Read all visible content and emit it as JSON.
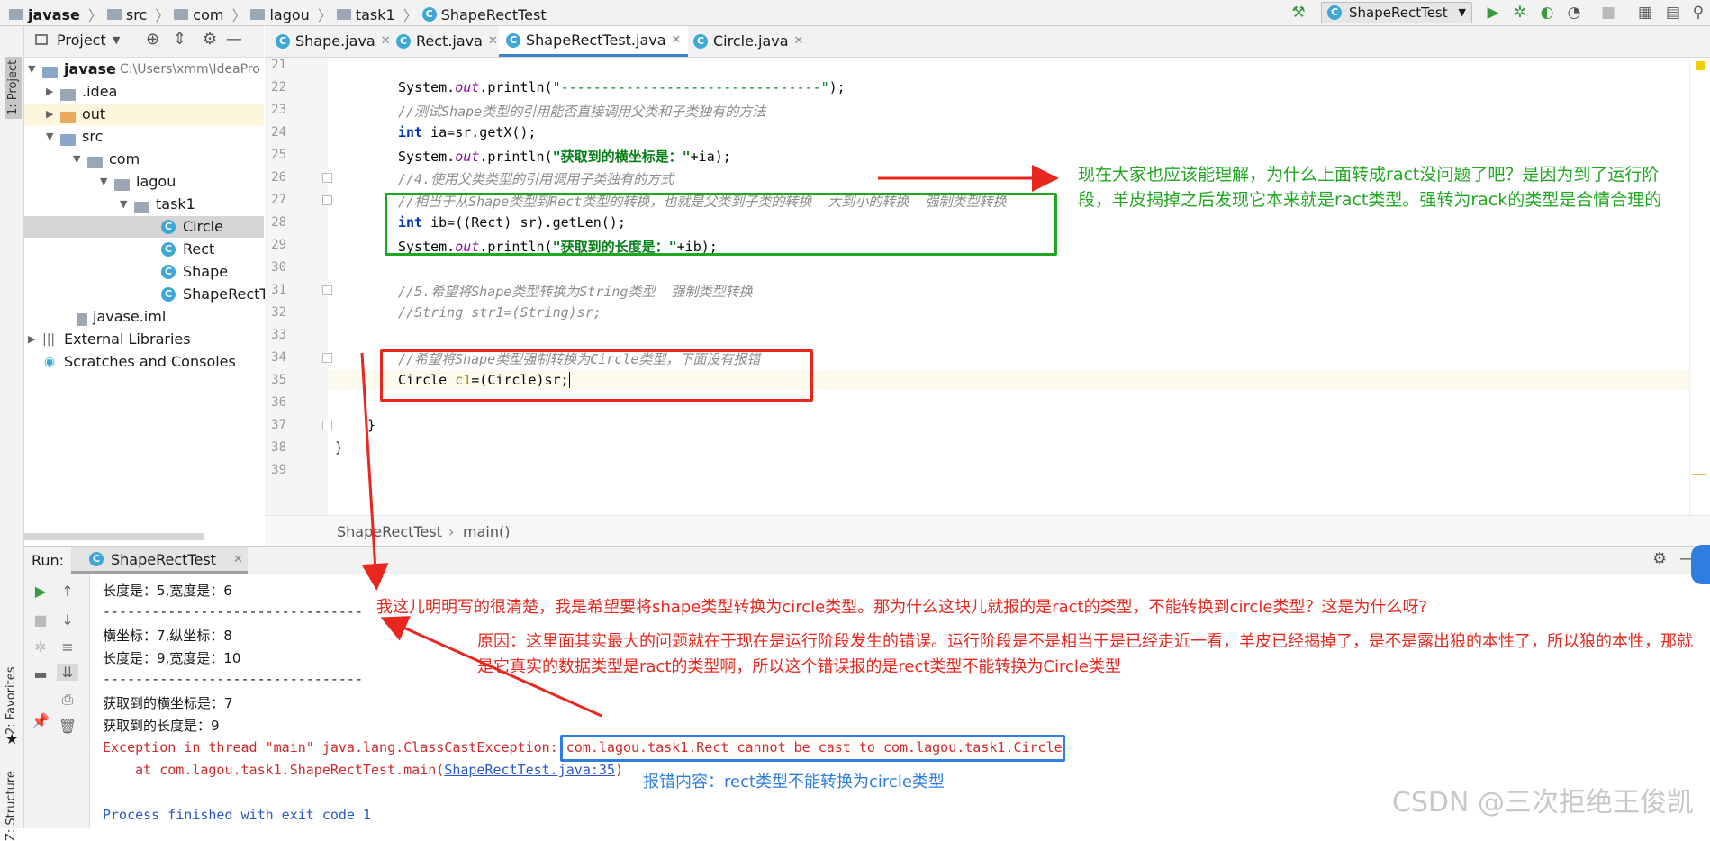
{
  "navbar": {
    "crumbs": [
      "javase",
      "src",
      "com",
      "lagou",
      "task1",
      "ShapeRectTest"
    ],
    "run_config": "ShapeRectTest"
  },
  "left_strip": {
    "project": "1: Project",
    "favorites": "2: Favorites",
    "structure": "Z: Structure"
  },
  "project_panel": {
    "title": "Project",
    "tree": [
      {
        "label": "javase",
        "hint": "C:\\Users\\xmm\\IdeaPro"
      },
      {
        "label": ".idea"
      },
      {
        "label": "out"
      },
      {
        "label": "src"
      },
      {
        "label": "com"
      },
      {
        "label": "lagou"
      },
      {
        "label": "task1"
      },
      {
        "label": "Circle"
      },
      {
        "label": "Rect"
      },
      {
        "label": "Shape"
      },
      {
        "label": "ShapeRectTe"
      },
      {
        "label": "javase.iml"
      },
      {
        "label": "External Libraries"
      },
      {
        "label": "Scratches and Consoles"
      }
    ]
  },
  "editor_tabs": [
    "Shape.java",
    "Rect.java",
    "ShapeRectTest.java",
    "Circle.java"
  ],
  "editor": {
    "line_numbers": [
      "21",
      "22",
      "23",
      "24",
      "25",
      "26",
      "27",
      "28",
      "29",
      "30",
      "31",
      "32",
      "33",
      "34",
      "35",
      "36",
      "37",
      "38",
      "39"
    ],
    "lines": {
      "l22a": "System.",
      "l22b": "out",
      "l22c": ".println(",
      "l22d": "\"--------------------------------\"",
      "l22e": ");",
      "l23": "//测试Shape类型的引用能否直接调用父类和子类独有的方法",
      "l24a": "int",
      "l24b": " ia=sr.getX();",
      "l25a": "System.",
      "l25b": "out",
      "l25c": ".println(",
      "l25d": "\"获取到的横坐标是：\"",
      "l25e": "+ia);",
      "l26": "//4.使用父类类型的引用调用子类独有的方式",
      "l27": "//相当于从Shape类型到Rect类型的转换，也就是父类到子类的转换  大到小的转换  强制类型转换",
      "l28a": "int",
      "l28b": " ib=((Rect) sr).getLen();",
      "l29a": "System.",
      "l29b": "out",
      "l29c": ".println(",
      "l29d": "\"获取到的长度是：\"",
      "l29e": "+ib);",
      "l31": "//5.希望将Shape类型转换为String类型  强制类型转换",
      "l32": "//String str1=(String)sr;",
      "l34": "//希望将Shape类型强制转换为Circle类型，下面没有报错",
      "l35a": "Circle ",
      "l35b": "c1",
      "l35c": "=(Circle)sr;",
      "l37": "}",
      "l38": "}"
    },
    "breadcrumb": [
      "ShapeRectTest",
      "main()"
    ]
  },
  "run_panel": {
    "label": "Run:",
    "tab": "ShapeRectTest",
    "console": [
      "长度是：5,宽度是：6",
      "--------------------------------",
      "横坐标：7,纵坐标：8",
      "长度是：9,宽度是：10",
      "--------------------------------",
      "获取到的横坐标是：7",
      "获取到的长度是：9"
    ],
    "exception_prefix": "Exception in thread \"main\" java.lang.ClassCastException: ",
    "exception_message": "com.lagou.task1.Rect cannot be cast to com.lagou.task1.Circle",
    "at_prefix": "    at com.lagou.task1.ShapeRectTest.main(",
    "at_link": "ShapeRectTest.java:35",
    "at_suffix": ")",
    "process_finished": "Process finished with exit code 1"
  },
  "annotations": {
    "green_note": "现在大家也应该能理解，为什么上面转成ract没问题了吧？是因为到了运行阶段，羊皮揭掉之后发现它本来就是ract类型。强转为rack的类型是合情合理的",
    "red_note_1": "我这儿明明写的很清楚，我是希望要将shape类型转换为circle类型。那为什么这块儿就报的是ract的类型，不能转换到circle类型？这是为什么呀?",
    "red_note_2": "原因：这里面其实最大的问题就在于现在是运行阶段发生的错误。运行阶段是不是相当于是已经走近一看，羊皮已经揭掉了，是不是露出狼的本性了，所以狼的本性，那就是它真实的数据类型是ract的类型啊，所以这个错误报的是rect类型不能转换为Circle类型",
    "blue_note": "报错内容：rect类型不能转换为circle类型",
    "colors": {
      "green": "#1fa81f",
      "red": "#e8281e",
      "blue": "#2e7de0"
    }
  },
  "watermark": "CSDN @三次拒绝王俊凯"
}
